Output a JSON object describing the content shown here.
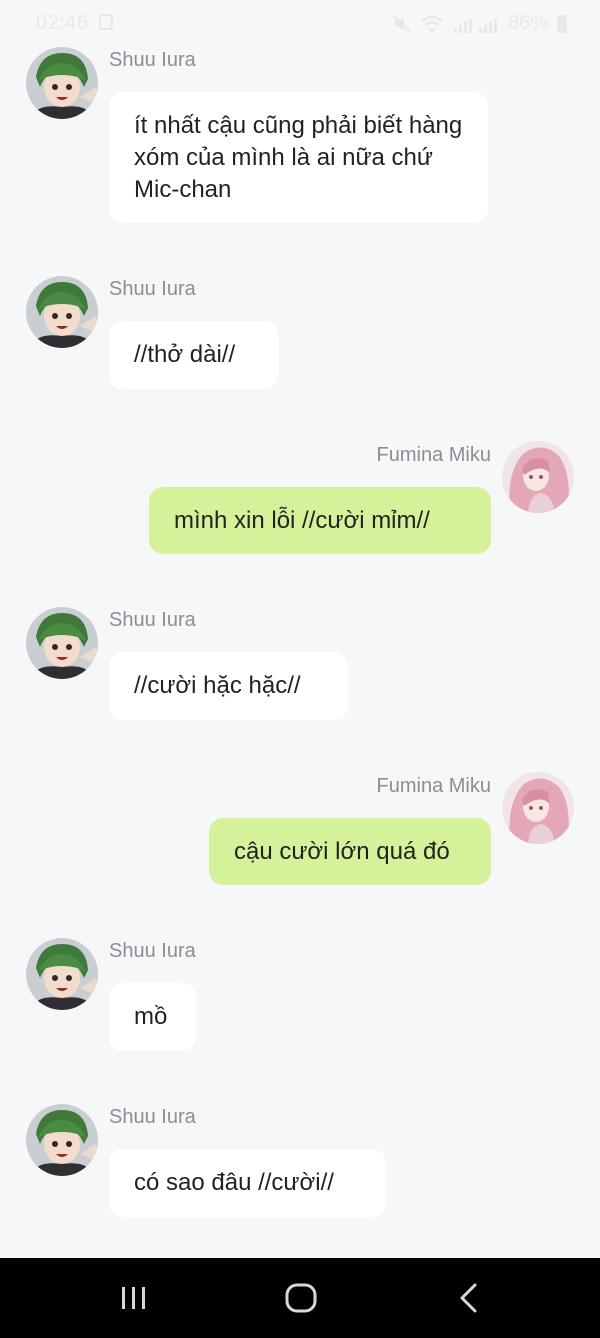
{
  "status": {
    "time": "02:46",
    "battery": "86%"
  },
  "messages": [
    {
      "side": "in",
      "sender": "Shuu Iura",
      "text": "ít nhất cậu cũng phải biết hàng xóm của mình là ai nữa chứ Mic-chan"
    },
    {
      "side": "in",
      "sender": "Shuu Iura",
      "text": "//thở dài//"
    },
    {
      "side": "out",
      "sender": "Fumina Miku",
      "text": "mình xin lỗi //cười mỉm//"
    },
    {
      "side": "in",
      "sender": "Shuu Iura",
      "text": "//cười hặc hặc//"
    },
    {
      "side": "out",
      "sender": "Fumina Miku",
      "text": "cậu cười lớn quá đó"
    },
    {
      "side": "in",
      "sender": "Shuu Iura",
      "text": "mồ"
    },
    {
      "side": "in",
      "sender": "Shuu Iura",
      "text": "có sao đâu //cười//"
    }
  ],
  "nav": {
    "recents_icon": "recents-icon",
    "home_icon": "home-icon",
    "back_icon": "back-icon"
  },
  "colors": {
    "background": "#f5f7f9",
    "incoming_bubble": "#ffffff",
    "outgoing_bubble": "#d5f29a",
    "sender_name": "#8a8f94"
  }
}
